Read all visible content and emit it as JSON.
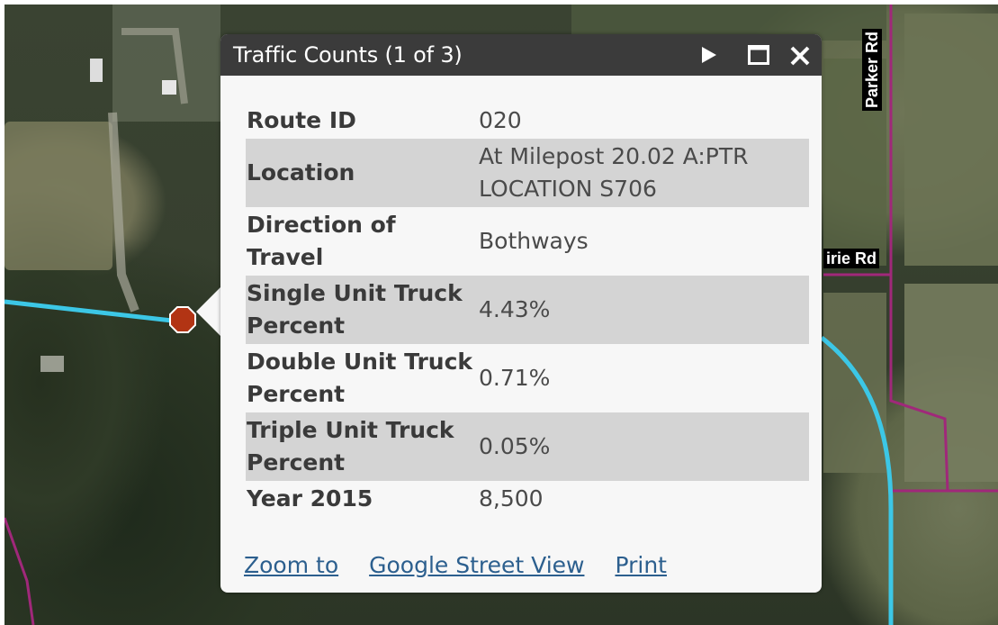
{
  "map": {
    "road_labels": {
      "parker_rd": "Parker Rd",
      "prairie_rd": "irie Rd"
    },
    "colors": {
      "highway_line": "#3cc7e6",
      "local_road_line": "#a0287a",
      "marker_fill": "#b23414"
    }
  },
  "popup": {
    "title": "Traffic Counts (1 of 3)",
    "icons": {
      "next": "play-triangle-icon",
      "maximize": "maximize-icon",
      "close": "close-icon"
    },
    "rows": [
      {
        "key": "Route ID",
        "value": "020"
      },
      {
        "key": "Location",
        "value": "At Milepost 20.02 A:PTR LOCATION S706"
      },
      {
        "key": "Direction of Travel",
        "value": "Bothways"
      },
      {
        "key": "Single Unit Truck Percent",
        "value": "4.43%"
      },
      {
        "key": "Double Unit Truck Percent",
        "value": "0.71%"
      },
      {
        "key": "Triple Unit Truck Percent",
        "value": "0.05%"
      },
      {
        "key": "Year 2015",
        "value": "8,500"
      }
    ],
    "links": {
      "zoom_to": "Zoom to",
      "street_view": "Google Street View",
      "print": "Print"
    }
  }
}
